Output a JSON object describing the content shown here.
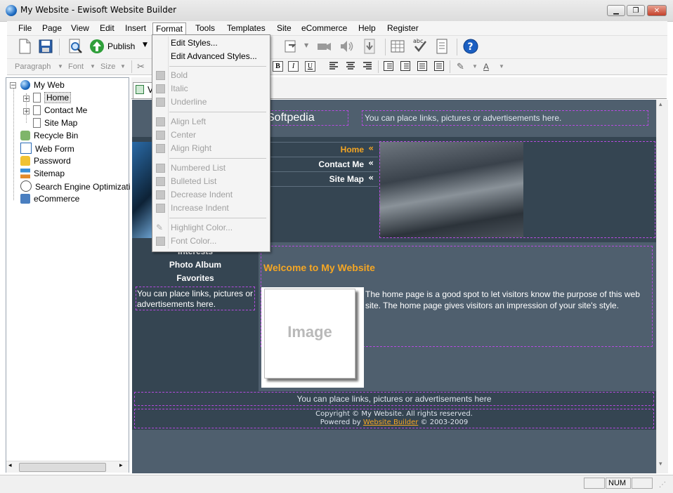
{
  "window": {
    "title": "My Website - Ewisoft Website Builder"
  },
  "menubar": [
    "File",
    "Page",
    "View",
    "Edit",
    "Insert",
    "Format",
    "Tools",
    "Templates",
    "Site",
    "eCommerce",
    "Help",
    "Register"
  ],
  "toolbar": {
    "publish_label": "Publish"
  },
  "format_toolbar": {
    "paragraph": "Paragraph",
    "font": "Font",
    "size": "Size",
    "bold": "B",
    "italic": "I",
    "underline": "U"
  },
  "format_menu": {
    "edit_styles": "Edit Styles...",
    "edit_advanced_styles": "Edit Advanced Styles...",
    "bold": "Bold",
    "italic": "Italic",
    "underline": "Underline",
    "align_left": "Align Left",
    "center": "Center",
    "align_right": "Align Right",
    "numbered_list": "Numbered List",
    "bulleted_list": "Bulleted List",
    "decrease_indent": "Decrease Indent",
    "increase_indent": "Increase Indent",
    "highlight_color": "Highlight Color...",
    "font_color": "Font Color..."
  },
  "tree": {
    "root": "My Web",
    "home": "Home",
    "contact": "Contact Me",
    "sitemap_page": "Site Map",
    "recycle": "Recycle Bin",
    "webform": "Web Form",
    "password": "Password",
    "sitemap": "Sitemap",
    "seo": "Search Engine Optimizati",
    "ecommerce": "eCommerce"
  },
  "editor": {
    "tab_label": "V"
  },
  "page": {
    "site_title": "Softpedia",
    "header_ad": "You can place links, pictures or advertisements here.",
    "nav": [
      "Home",
      "Contact Me",
      "Site Map"
    ],
    "nav_marker": "«",
    "sidebar_links": [
      "Interests",
      "Photo Album",
      "Favorites"
    ],
    "sidebar_ad": "You can place links, pictures or advertisements here.",
    "welcome": "Welcome to My Website",
    "image_placeholder": "Image",
    "body_text": "The home page is a good spot to let visitors know the purpose of this web site. The home page gives visitors an impression of your site's style.",
    "footer_ad": "You can place links, pictures or advertisements here",
    "copyright": "Copyright © My Website. All rights reserved.",
    "powered_prefix": "Powered by",
    "powered_link": "Website Builder",
    "powered_suffix": "© 2003-2009"
  },
  "statusbar": {
    "num": "NUM"
  },
  "colors": {
    "accent_orange": "#f5a623",
    "page_bg": "#4f5f6e",
    "dark_band": "#354552"
  }
}
